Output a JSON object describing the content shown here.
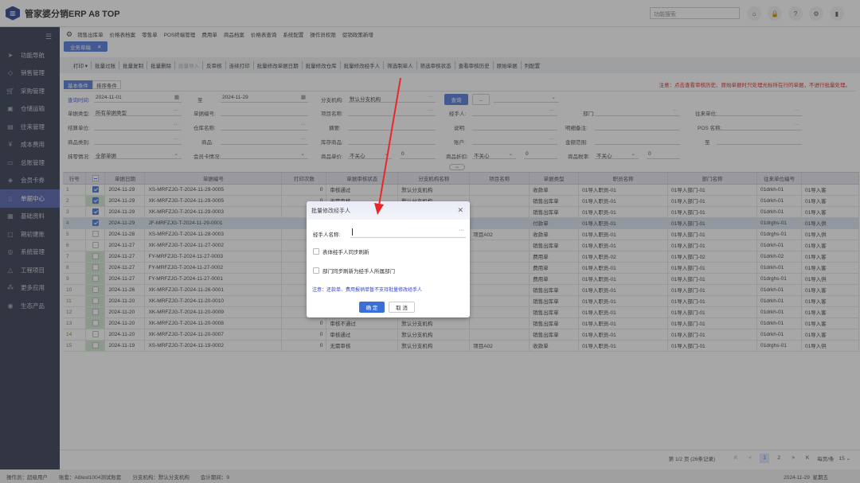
{
  "app": {
    "title": "管家婆分销ERP A8 TOP",
    "search_placeholder": "功能搜索"
  },
  "top_icons": [
    {
      "name": "home-icon",
      "glyph": "⌂"
    },
    {
      "name": "lock-icon",
      "glyph": "🔒"
    },
    {
      "name": "help-icon",
      "glyph": "?"
    },
    {
      "name": "settings-icon",
      "glyph": "⚙"
    },
    {
      "name": "exit-icon",
      "glyph": "▮"
    }
  ],
  "sidebar": {
    "items": [
      {
        "label": "功能导航",
        "icon": "➤",
        "name": "navigate-icon"
      },
      {
        "label": "销售管理",
        "icon": "◇",
        "name": "tag-icon"
      },
      {
        "label": "采购管理",
        "icon": "🛒",
        "name": "cart-icon"
      },
      {
        "label": "仓储运输",
        "icon": "▣",
        "name": "warehouse-icon"
      },
      {
        "label": "往来管理",
        "icon": "▤",
        "name": "ledger-icon"
      },
      {
        "label": "成本费用",
        "icon": "¥",
        "name": "cost-icon"
      },
      {
        "label": "总账管理",
        "icon": "▭",
        "name": "monitor-icon"
      },
      {
        "label": "会员卡券",
        "icon": "◈",
        "name": "gem-icon"
      },
      {
        "label": "单据中心",
        "icon": "▯",
        "name": "clipboard-icon",
        "active": true
      },
      {
        "label": "基础资料",
        "icon": "▦",
        "name": "data-icon"
      },
      {
        "label": "期初建账",
        "icon": "▢",
        "name": "book-icon"
      },
      {
        "label": "系统管理",
        "icon": "◎",
        "name": "system-icon"
      },
      {
        "label": "工程项目",
        "icon": "△",
        "name": "project-icon"
      },
      {
        "label": "更多应用",
        "icon": "⁂",
        "name": "apps-icon"
      },
      {
        "label": "生态产品",
        "icon": "◉",
        "name": "eco-icon"
      }
    ]
  },
  "menubar": [
    "销售出库单",
    "价格表档案",
    "零售单",
    "POS终端管理",
    "费用单",
    "商品档案",
    "价格表查询",
    "系统配置",
    "操作员权限",
    "促销政策新增"
  ],
  "open_tab": "业务草稿",
  "toolbar": [
    {
      "label": "打印 ▾"
    },
    {
      "label": "批量过账"
    },
    {
      "label": "批量复制"
    },
    {
      "label": "批量删除"
    },
    {
      "label": "批量导入",
      "disabled": true
    },
    {
      "label": "反审核"
    },
    {
      "label": "连续打印"
    },
    {
      "label": "批量修改单据日期"
    },
    {
      "label": "批量修改仓库"
    },
    {
      "label": "批量修改经手人"
    },
    {
      "label": "筛选制单人"
    },
    {
      "label": "筛选审核状态"
    },
    {
      "label": "查看审核历史"
    },
    {
      "label": "原始单据"
    },
    {
      "label": "列配置"
    }
  ],
  "cond_tabs": [
    "基本条件",
    "排序条件"
  ],
  "notice": "注意：点击查看审核历史、原始单据时只处理光标所在行的单据，不进行批量处理。",
  "form": {
    "query_time_label": "查询时间:",
    "date_from": "2024-11-01",
    "to_label": "至",
    "date_to": "2024-11-29",
    "branch_label": "分支机构:",
    "branch_value": "默认分支机构",
    "query_button": "查询",
    "more_button": "...",
    "doc_type_label": "单据类型:",
    "doc_type_value": "所有单据类型",
    "doc_no_label": "单据编号:",
    "project_label": "项目名称:",
    "handler_label": "经手人:",
    "dept_label": "部门:",
    "partner_label": "往来单位:",
    "settle_label": "结算单位:",
    "warehouse_label": "仓库名称:",
    "summary_label": "摘要:",
    "desc_label": "说明:",
    "detail_note_label": "明细备注:",
    "pos_label": "POS 名称:",
    "goods_cat_label": "商品类别:",
    "goods_label": "商品:",
    "stock_goods_label": "库存商品:",
    "account_label": "账户:",
    "amount_label": "金额范围:",
    "amount_to_label": "至",
    "rounding_label": "抹零情况:",
    "rounding_value": "全部单据",
    "member_label": "会员卡情况:",
    "price_label": "商品单价:",
    "price_mode": "不关心",
    "price_value": "0",
    "discount_label": "商品折扣:",
    "discount_mode": "不关心",
    "discount_value": "0",
    "tax_label": "商品税率:",
    "tax_mode": "不关心",
    "tax_value": "0"
  },
  "table": {
    "columns": [
      "行号",
      "",
      "单据日期",
      "单据编号",
      "打印次数",
      "单据审核状态",
      "分支机构名称",
      "项目名称",
      "单据类型",
      "职员名称",
      "部门名称",
      "往来单位编号",
      ""
    ],
    "rows": [
      {
        "no": "1",
        "checked": true,
        "green": false,
        "date": "2024-11-29",
        "code": "XS-MRFZJG-T-2024-11-29-0005",
        "print": "0",
        "audit": "审核通过",
        "branch": "默认分支机构",
        "project": "",
        "type": "收款单",
        "staff": "01导入职员-01",
        "dept": "01导入部门-01",
        "partner": "01drkh-01",
        "extra": "01导入客"
      },
      {
        "no": "2",
        "checked": true,
        "green": true,
        "date": "2024-11-29",
        "code": "XK-MRFZJG-T-2024-11-29-0005",
        "print": "0",
        "audit": "无需审核",
        "branch": "默认分支机构",
        "project": "",
        "type": "销售出库单",
        "staff": "01导入职员-01",
        "dept": "01导入部门-01",
        "partner": "01drkh-01",
        "extra": "01导入客"
      },
      {
        "no": "3",
        "checked": true,
        "green": false,
        "date": "2024-11-29",
        "code": "XK-MRFZJG-T-2024-11-29-0003",
        "print": "",
        "audit": "",
        "branch": "",
        "project": "",
        "type": "销售出库单",
        "staff": "01导入职员-01",
        "dept": "01导入部门-01",
        "partner": "01drkh-01",
        "extra": "01导入客"
      },
      {
        "no": "4",
        "checked": true,
        "green": false,
        "selected": true,
        "date": "2024-11-29",
        "code": "JF-MRFZJG-T-2024-11-29-0001",
        "print": "",
        "audit": "",
        "branch": "",
        "project": "",
        "type": "付款单",
        "staff": "01导入职员-01",
        "dept": "01导入部门-01",
        "partner": "01drghs-01",
        "extra": "01导入供"
      },
      {
        "no": "5",
        "checked": false,
        "green": false,
        "date": "2024-11-28",
        "code": "XS-MRFZJG-T-2024-11-28-0003",
        "print": "",
        "audit": "",
        "branch": "",
        "project": "项目A02",
        "type": "收款单",
        "staff": "01导入职员-01",
        "dept": "01导入部门-01",
        "partner": "01drghs-01",
        "extra": "01导入供"
      },
      {
        "no": "6",
        "checked": false,
        "green": false,
        "date": "2024-11-27",
        "code": "XK-MRFZJG-T-2024-11-27-0002",
        "print": "",
        "audit": "",
        "branch": "",
        "project": "",
        "type": "销售出库单",
        "staff": "01导入职员-01",
        "dept": "01导入部门-01",
        "partner": "01drkh-01",
        "extra": "01导入客"
      },
      {
        "no": "7",
        "checked": false,
        "green": true,
        "date": "2024-11-27",
        "code": "FY-MRFZJG-T-2024-11-27-0003",
        "print": "",
        "audit": "",
        "branch": "",
        "project": "",
        "type": "费用单",
        "staff": "01导入职员-02",
        "dept": "01导入部门-02",
        "partner": "01drkh-02",
        "extra": "01导入客"
      },
      {
        "no": "8",
        "checked": false,
        "green": true,
        "date": "2024-11-27",
        "code": "FY-MRFZJG-T-2024-11-27-0002",
        "print": "",
        "audit": "",
        "branch": "",
        "project": "",
        "type": "费用单",
        "staff": "01导入职员-01",
        "dept": "01导入部门-01",
        "partner": "01drkh-01",
        "extra": "01导入客"
      },
      {
        "no": "9",
        "checked": false,
        "green": true,
        "date": "2024-11-27",
        "code": "FY-MRFZJG-T-2024-11-27-0001",
        "print": "",
        "audit": "",
        "branch": "",
        "project": "",
        "type": "费用单",
        "staff": "01导入职员-01",
        "dept": "01导入部门-01",
        "partner": "01drghs-01",
        "extra": "01导入供"
      },
      {
        "no": "10",
        "checked": false,
        "green": true,
        "date": "2024-11-26",
        "code": "XK-MRFZJG-T-2024-11-26-0001",
        "print": "",
        "audit": "",
        "branch": "",
        "project": "",
        "type": "销售出库单",
        "staff": "01导入职员-01",
        "dept": "01导入部门-01",
        "partner": "01drkh-01",
        "extra": "01导入客"
      },
      {
        "no": "11",
        "checked": false,
        "green": true,
        "date": "2024-11-20",
        "code": "XK-MRFZJG-T-2024-11-20-0010",
        "print": "",
        "audit": "",
        "branch": "",
        "project": "",
        "type": "销售出库单",
        "staff": "01导入职员-01",
        "dept": "01导入部门-01",
        "partner": "01drkh-01",
        "extra": "01导入客"
      },
      {
        "no": "12",
        "checked": false,
        "green": true,
        "date": "2024-11-20",
        "code": "XK-MRFZJG-T-2024-11-20-0009",
        "print": "",
        "audit": "",
        "branch": "",
        "project": "",
        "type": "销售出库单",
        "staff": "01导入职员-01",
        "dept": "01导入部门-01",
        "partner": "01drkh-01",
        "extra": "01导入客"
      },
      {
        "no": "13",
        "checked": false,
        "green": true,
        "date": "2024-11-20",
        "code": "XK-MRFZJG-T-2024-11-20-0008",
        "print": "0",
        "audit": "审核不通过",
        "branch": "默认分支机构",
        "project": "",
        "type": "销售出库单",
        "staff": "01导入职员-01",
        "dept": "01导入部门-01",
        "partner": "01drkh-01",
        "extra": "01导入客"
      },
      {
        "no": "14",
        "checked": false,
        "green": false,
        "date": "2024-11-20",
        "code": "XK-MRFZJG-T-2024-11-20-0007",
        "print": "0",
        "audit": "审核通过",
        "branch": "默认分支机构",
        "project": "",
        "type": "销售出库单",
        "staff": "01导入职员-01",
        "dept": "01导入部门-01",
        "partner": "01drkh-01",
        "extra": "01导入客"
      },
      {
        "no": "15",
        "checked": false,
        "green": true,
        "date": "2024-11-19",
        "code": "XS-MRFZJG-T-2024-11-19-0002",
        "print": "0",
        "audit": "无需审核",
        "branch": "默认分支机构",
        "project": "项目A02",
        "type": "收款单",
        "staff": "01导入职员-01",
        "dept": "01导入部门-01",
        "partner": "01drghs-01",
        "extra": "01导入供"
      }
    ]
  },
  "pager": {
    "info": "第 1/2 页 (26条记录)",
    "first": "K",
    "prev": "<",
    "pages": [
      "1",
      "2"
    ],
    "current": "1",
    "next": ">",
    "last": "K",
    "per_page_label": "每页/条",
    "per_page": "15"
  },
  "status": {
    "operator": "操作员：超级用户",
    "account": "账套：A8test1004测试账套",
    "branch": "分支机构：默认分支机构",
    "period": "会计期间：9",
    "date": "2024-11-29",
    "weekday": "星期五"
  },
  "dialog": {
    "title": "批量修改经手人",
    "handler_label": "经手人名称:",
    "handler_value": "",
    "opt1": "表体经手人同步刷新",
    "opt2": "部门同步刷新为经手人所属部门",
    "note": "注意：还款单、费用报销单暂不支持批量修改经手人",
    "ok": "确 定",
    "cancel": "取 消"
  }
}
